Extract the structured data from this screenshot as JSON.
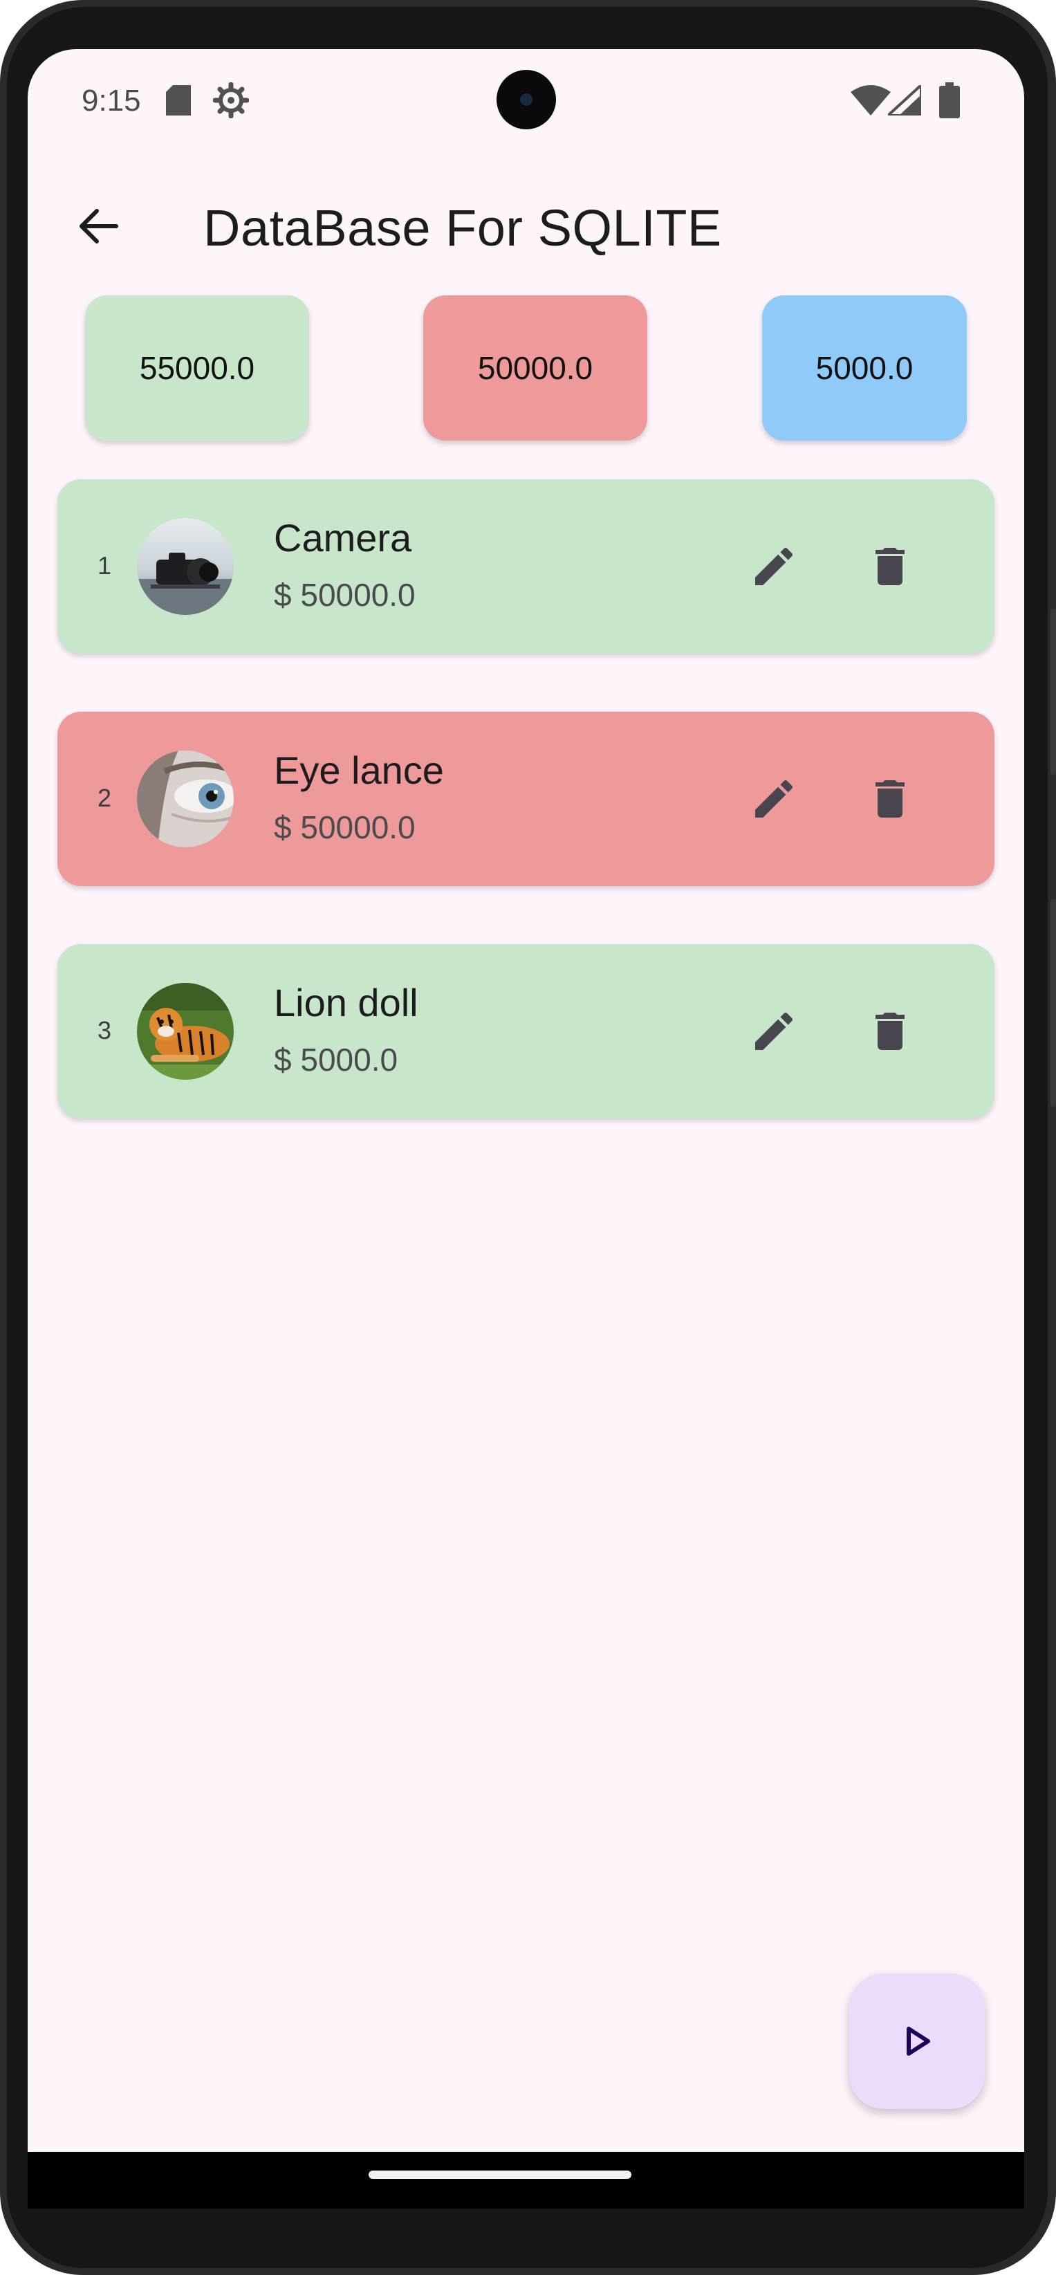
{
  "status_bar": {
    "time": "9:15",
    "icons": [
      "sd-card-icon",
      "settings-icon",
      "wifi-icon",
      "signal-icon",
      "battery-icon"
    ]
  },
  "app_bar": {
    "title": "DataBase For SQLITE",
    "back_icon": "arrow-back-icon"
  },
  "totals": [
    {
      "value": "55000.0",
      "color": "#c8e6c9"
    },
    {
      "value": "50000.0",
      "color": "#ef9a9a"
    },
    {
      "value": "5000.0",
      "color": "#90caf9"
    }
  ],
  "items": [
    {
      "index": "1",
      "name": "Camera",
      "price": "$ 50000.0",
      "color": "#c8e6c9",
      "image": "camera-photo"
    },
    {
      "index": "2",
      "name": "Eye lance",
      "price": "$ 50000.0",
      "color": "#ef9a9a",
      "image": "eye-photo"
    },
    {
      "index": "3",
      "name": "Lion doll",
      "price": "$ 5000.0",
      "color": "#c8e6c9",
      "image": "tiger-photo"
    }
  ],
  "fab": {
    "icon": "play-arrow-icon",
    "color": "#eaddfb"
  }
}
